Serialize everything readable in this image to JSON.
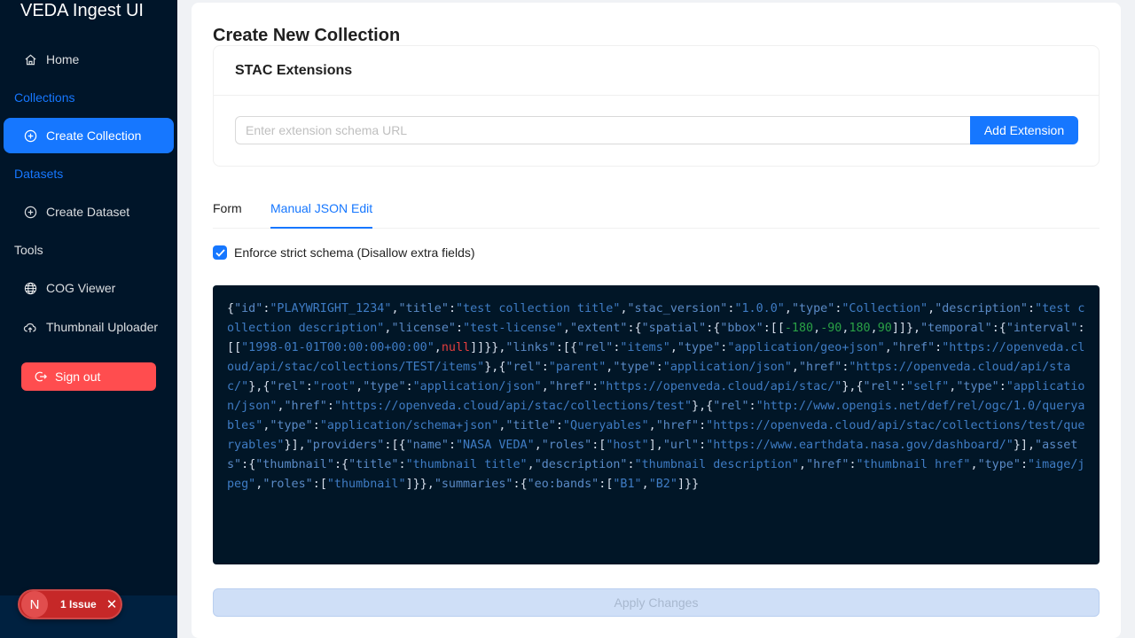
{
  "app": {
    "title": "VEDA Ingest UI"
  },
  "sidebar": {
    "home": "Home",
    "collections_group": "Collections",
    "create_collection": "Create Collection",
    "datasets_group": "Datasets",
    "create_dataset": "Create Dataset",
    "tools_group": "Tools",
    "cog_viewer": "COG Viewer",
    "thumbnail_uploader": "Thumbnail Uploader",
    "sign_out": "Sign out"
  },
  "issue_badge": {
    "letter": "N",
    "label": "1 Issue"
  },
  "main": {
    "title": "Create New Collection",
    "extensions": {
      "title": "STAC Extensions",
      "placeholder": "Enter extension schema URL",
      "add_label": "Add Extension"
    },
    "tabs": [
      {
        "label": "Form",
        "active": false
      },
      {
        "label": "Manual JSON Edit",
        "active": true
      }
    ],
    "strict_schema": {
      "label": "Enforce strict schema (Disallow extra fields)",
      "checked": true
    },
    "json_text": "{\"id\":\"PLAYWRIGHT_1234\",\"title\":\"test collection title\",\"stac_version\":\"1.0.0\",\"type\":\"Collection\",\"description\":\"test collection description\",\"license\":\"test-license\",\"extent\":{\"spatial\":{\"bbox\":[[-180,-90,180,90]]},\"temporal\":{\"interval\":[[\"1998-01-01T00:00:00+00:00\",null]]}},\"links\":[{\"rel\":\"items\",\"type\":\"application/geo+json\",\"href\":\"https://openveda.cloud/api/stac/collections/TEST/items\"},{\"rel\":\"parent\",\"type\":\"application/json\",\"href\":\"https://openveda.cloud/api/stac/\"},{\"rel\":\"root\",\"type\":\"application/json\",\"href\":\"https://openveda.cloud/api/stac/\"},{\"rel\":\"self\",\"type\":\"application/json\",\"href\":\"https://openveda.cloud/api/stac/collections/test\"},{\"rel\":\"http://www.opengis.net/def/rel/ogc/1.0/queryables\",\"type\":\"application/schema+json\",\"title\":\"Queryables\",\"href\":\"https://openveda.cloud/api/stac/collections/test/queryables\"}],\"providers\":[{\"name\":\"NASA VEDA\",\"roles\":[\"host\"],\"url\":\"https://www.earthdata.nasa.gov/dashboard/\"}],\"assets\":{\"thumbnail\":{\"title\":\"thumbnail title\",\"description\":\"thumbnail description\",\"href\":\"thumbnail href\",\"type\":\"image/jpeg\",\"roles\":[\"thumbnail\"]}},\"summaries\":{\"eo:bands\":[\"B1\",\"B2\"]}}",
    "apply_label": "Apply Changes"
  },
  "colors": {
    "sidebar_bg": "#001529",
    "accent": "#1677ff",
    "danger": "#ff4d4f",
    "code_bg": "#011627"
  }
}
